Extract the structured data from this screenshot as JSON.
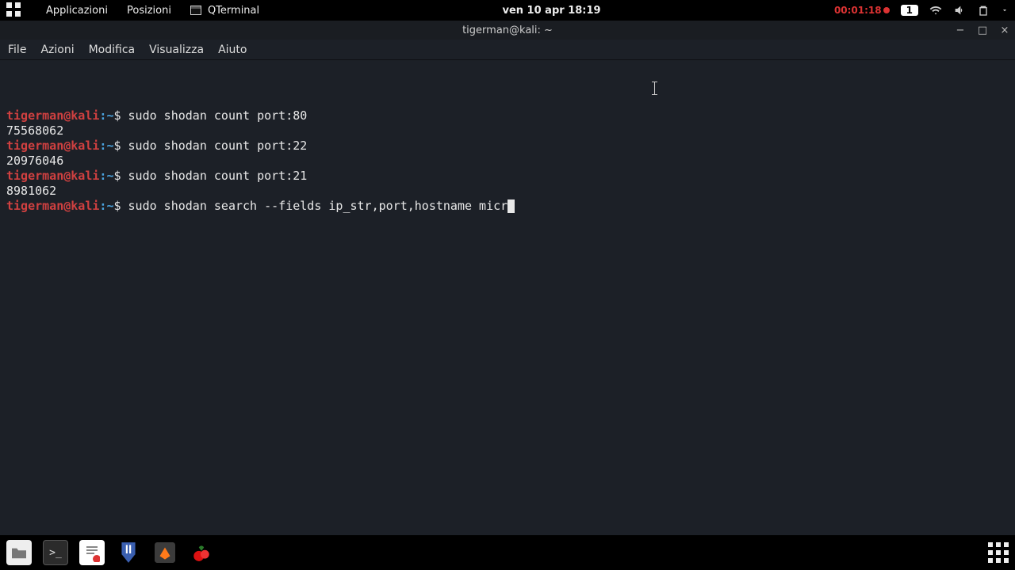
{
  "panel": {
    "applications": "Applicazioni",
    "positions": "Posizioni",
    "task_label": "QTerminal",
    "datetime": "ven 10 apr  18:19",
    "rec_time": "00:01:18",
    "workspace": "1"
  },
  "window": {
    "title": "tigerman@kali: ~",
    "menus": [
      "File",
      "Azioni",
      "Modifica",
      "Visualizza",
      "Aiuto"
    ]
  },
  "prompt": {
    "user": "tigerman",
    "at": "@",
    "host": "kali",
    "sep": ":",
    "path": "~",
    "dollar": "$ "
  },
  "terminal": {
    "lines": [
      {
        "type": "cmd",
        "text": "sudo shodan count port:80"
      },
      {
        "type": "out",
        "text": "75568062"
      },
      {
        "type": "cmd",
        "text": "sudo shodan count port:22"
      },
      {
        "type": "out",
        "text": "20976046"
      },
      {
        "type": "cmd",
        "text": "sudo shodan count port:21"
      },
      {
        "type": "out",
        "text": "8981062"
      },
      {
        "type": "cmd_cursor",
        "text": "sudo shodan search --fields ip_str,port,hostname micr"
      }
    ]
  },
  "dock": {
    "items": [
      "files-icon",
      "terminal-icon",
      "text-editor-icon",
      "metasploit-icon",
      "burp-icon",
      "cherrytree-icon"
    ]
  }
}
